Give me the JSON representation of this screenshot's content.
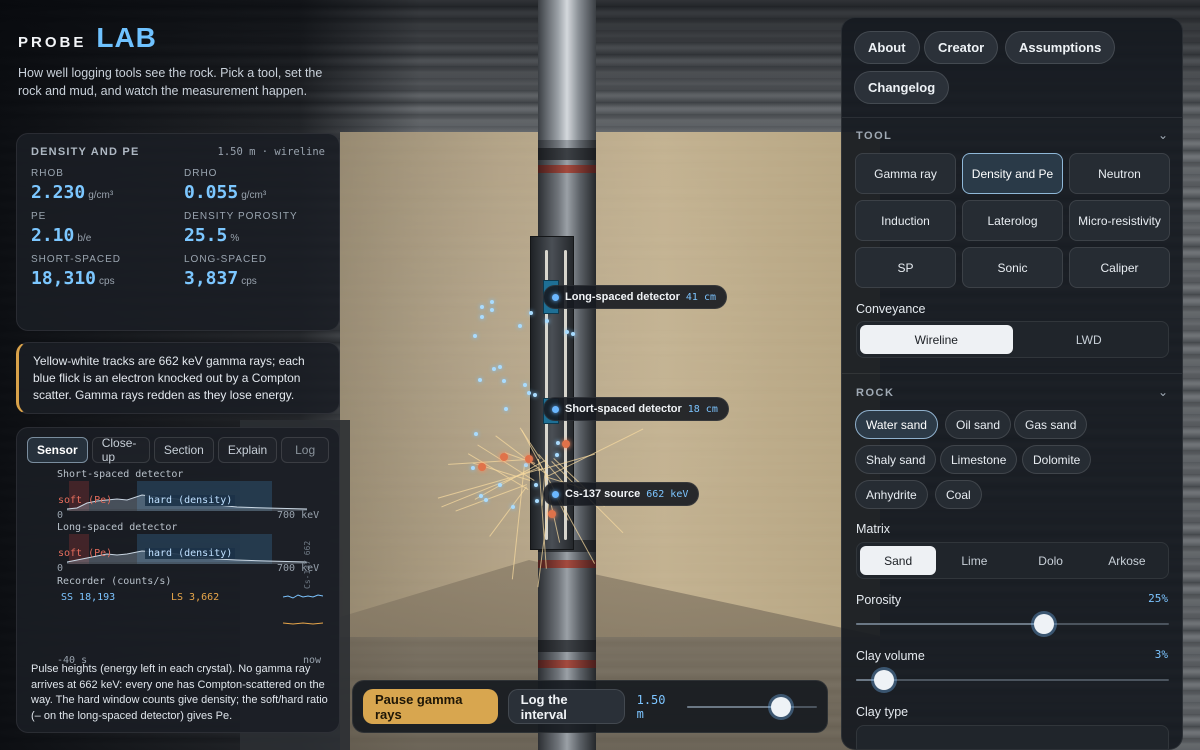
{
  "brand": {
    "probe": "PROBE",
    "lab": "LAB",
    "tagline": "How well logging tools see the rock. Pick a tool, set the rock and mud, and watch the measurement happen."
  },
  "readout": {
    "title": "DENSITY AND PE",
    "subtitle": "1.50 m · wireline",
    "metrics": [
      {
        "label": "RHOB",
        "value": "2.230",
        "unit": "g/cm³"
      },
      {
        "label": "DRHO",
        "value": "0.055",
        "unit": "g/cm³"
      },
      {
        "label": "PE",
        "value": "2.10",
        "unit": "b/e"
      },
      {
        "label": "DENSITY POROSITY",
        "value": "25.5",
        "unit": "%"
      },
      {
        "label": "SHORT-SPACED",
        "value": "18,310",
        "unit": "cps"
      },
      {
        "label": "LONG-SPACED",
        "value": "3,837",
        "unit": "cps"
      }
    ]
  },
  "note": {
    "text": "Yellow-white tracks are 662 keV gamma rays; each blue flick is an electron knocked out by a Compton scatter. Gamma rays redden as they lose energy."
  },
  "sensor": {
    "tabs": [
      "Sensor",
      "Close-up",
      "Section",
      "Explain",
      "Log"
    ],
    "active_tab": 0,
    "short_label": "Short-spaced detector",
    "long_label": "Long-spaced detector",
    "soft_label": "soft (Pe)",
    "hard_label": "hard (density)",
    "axis_min": "0",
    "axis_max": "700 keV",
    "vert_label": "Cs-137 662",
    "recorder_label": "Recorder (counts/s)",
    "ss_reading": "SS 18,193",
    "ls_reading": "LS 3,662",
    "time_start": "-40 s",
    "time_end": "now",
    "footnote": "Pulse heights (energy left in each crystal). No gamma ray arrives at 662 keV: every one has Compton-scattered on the way. The hard window counts give density; the soft/hard ratio (– on the long-spaced detector) gives Pe."
  },
  "scene": {
    "callouts": [
      {
        "label": "Long-spaced detector",
        "value": "41 cm"
      },
      {
        "label": "Short-spaced detector",
        "value": "18 cm"
      },
      {
        "label": "Cs-137 source",
        "value": "662 keV"
      }
    ]
  },
  "controls": {
    "pause_label": "Pause gamma rays",
    "log_label": "Log the interval",
    "interval_value": "1.50 m",
    "interval_fraction": 0.72
  },
  "side": {
    "top_buttons": [
      "About",
      "Creator",
      "Assumptions",
      "Changelog"
    ],
    "tool_section": "TOOL",
    "tools": [
      "Gamma ray",
      "Density and Pe",
      "Neutron",
      "Induction",
      "Laterolog",
      "Micro-resistivity",
      "SP",
      "Sonic",
      "Caliper"
    ],
    "selected_tool": "Density and Pe",
    "conveyance_label": "Conveyance",
    "conveyance_options": [
      "Wireline",
      "LWD"
    ],
    "conveyance_selected": "Wireline",
    "rock_section": "ROCK",
    "rocks": [
      "Water sand",
      "Oil sand",
      "Gas sand",
      "Shaly sand",
      "Limestone",
      "Dolomite",
      "Anhydrite",
      "Coal"
    ],
    "selected_rock": "Water sand",
    "matrix_label": "Matrix",
    "matrix_options": [
      "Sand",
      "Lime",
      "Dolo",
      "Arkose"
    ],
    "matrix_selected": "Sand",
    "porosity_label": "Porosity",
    "porosity_value": "25%",
    "porosity_fraction": 0.6,
    "clay_label": "Clay volume",
    "clay_value": "3%",
    "clay_fraction": 0.09,
    "clay_type_label": "Clay type"
  },
  "colors": {
    "accent": "#6fc2ff",
    "primary_button": "#d8a64f",
    "soft_window": "#e46c5c",
    "ss_trace": "#7cc4ff",
    "ls_trace": "#e8a64a"
  }
}
